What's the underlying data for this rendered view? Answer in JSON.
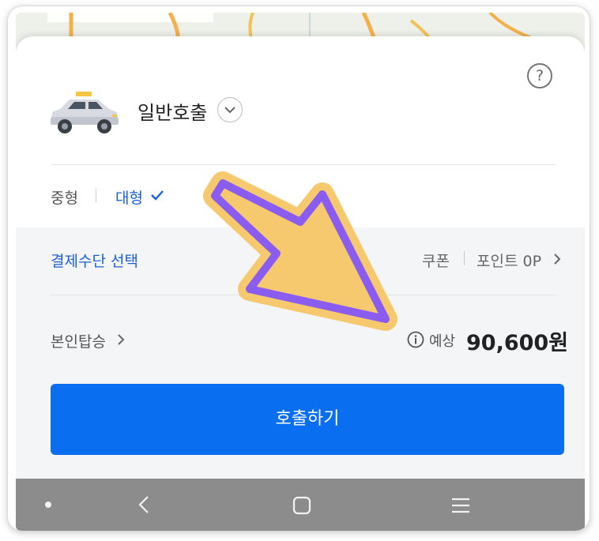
{
  "vehicle": {
    "call_type": "일반호출"
  },
  "size_options": {
    "medium": "중형",
    "large": "대형"
  },
  "payment": {
    "select_label": "결제수단 선택",
    "coupon_label": "쿠폰",
    "point_label": "포인트 0P"
  },
  "boarding": {
    "self_label": "본인탑승"
  },
  "fare": {
    "estimate_label": "예상",
    "estimate_value": "90,600원"
  },
  "call_button_label": "호출하기",
  "colors": {
    "accent_blue": "#1a5fd6",
    "button_blue": "#0a6ef0",
    "highlight_arrow_fill": "#f7c96f",
    "highlight_arrow_stroke": "#8a5cf0",
    "navbar": "#8c8c8c"
  },
  "icons": {
    "help": "help-circle-icon",
    "call_type_dropdown": "chevron-down-icon",
    "selected": "check-icon",
    "info": "info-icon",
    "nav_dot": "dot-icon",
    "nav_back": "back-icon",
    "nav_home": "home-icon",
    "nav_menu": "menu-icon"
  }
}
